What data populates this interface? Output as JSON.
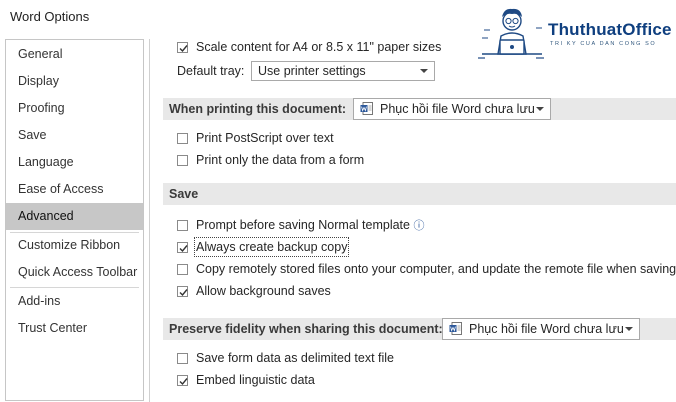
{
  "window": {
    "title": "Word Options"
  },
  "sidebar": {
    "items": [
      {
        "label": "General"
      },
      {
        "label": "Display"
      },
      {
        "label": "Proofing"
      },
      {
        "label": "Save"
      },
      {
        "label": "Language"
      },
      {
        "label": "Ease of Access"
      },
      {
        "label": "Advanced",
        "active": true
      },
      {
        "label": "Customize Ribbon"
      },
      {
        "label": "Quick Access Toolbar"
      },
      {
        "label": "Add-ins"
      },
      {
        "label": "Trust Center"
      }
    ]
  },
  "logo": {
    "brand": "ThuthuatOffice",
    "tagline": "TRI KY CUA DAN CONG SO"
  },
  "print": {
    "scale_content": {
      "label": "Scale content for A4 or 8.5 x 11\" paper sizes",
      "checked": true
    },
    "default_tray": {
      "label": "Default tray:",
      "value": "Use printer settings"
    }
  },
  "printing_doc": {
    "header": "When printing this document:",
    "doc_select": "Phục hồi file Word chưa lưu",
    "options": [
      {
        "label": "Print PostScript over text",
        "checked": false
      },
      {
        "label": "Print only the data from a form",
        "checked": false
      }
    ]
  },
  "save": {
    "header": "Save",
    "options": [
      {
        "label": "Prompt before saving Normal template",
        "checked": false,
        "info": "ⓘ"
      },
      {
        "label": "Always create backup copy",
        "checked": true
      },
      {
        "label": "Copy remotely stored files onto your computer, and update the remote file when saving",
        "checked": false
      },
      {
        "label": "Allow background saves",
        "checked": true
      }
    ]
  },
  "fidelity": {
    "header": "Preserve fidelity when sharing this document:",
    "doc_select": "Phục hồi file Word chưa lưu",
    "options": [
      {
        "label": "Save form data as delimited text file",
        "checked": false
      },
      {
        "label": "Embed linguistic data",
        "checked": true
      }
    ]
  },
  "colors": {
    "accent_blue": "#2b579a",
    "section_bg": "#e8e8e8",
    "active_nav": "#c7c7c7"
  },
  "icons": [
    "checkmark-icon",
    "word-document-icon",
    "chevron-down-icon",
    "info-icon"
  ]
}
